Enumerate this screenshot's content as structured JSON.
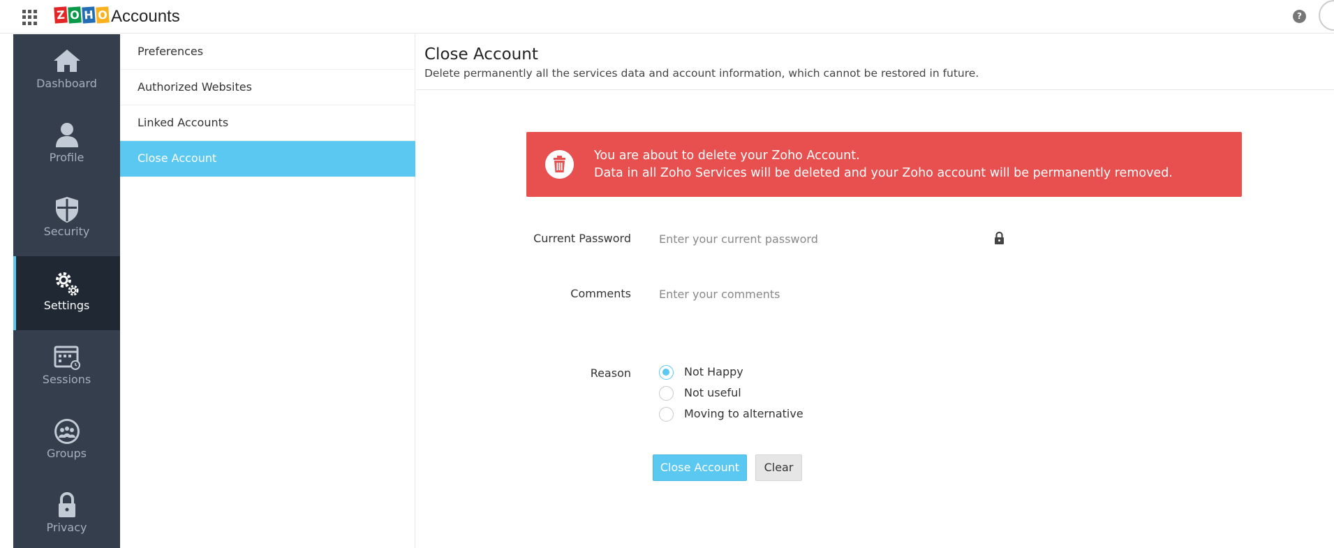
{
  "header": {
    "apps_icon": "apps-grid-icon",
    "logo_letters": [
      "Z",
      "O",
      "H",
      "O"
    ],
    "app_title": "Accounts",
    "help_icon": "help-icon",
    "help_glyph": "?"
  },
  "leftnav": {
    "items": [
      {
        "label": "Dashboard",
        "icon": "home-icon"
      },
      {
        "label": "Profile",
        "icon": "user-icon"
      },
      {
        "label": "Security",
        "icon": "shield-icon"
      },
      {
        "label": "Settings",
        "icon": "gears-icon",
        "active": true
      },
      {
        "label": "Sessions",
        "icon": "calendar-clock-icon"
      },
      {
        "label": "Groups",
        "icon": "group-icon"
      },
      {
        "label": "Privacy",
        "icon": "lock-icon"
      }
    ]
  },
  "submenu": {
    "items": [
      {
        "label": "Preferences"
      },
      {
        "label": "Authorized Websites"
      },
      {
        "label": "Linked Accounts"
      },
      {
        "label": "Close Account",
        "active": true
      }
    ]
  },
  "main": {
    "title": "Close Account",
    "description": "Delete permanently all the services data and account information, which cannot be restored in future.",
    "alert": {
      "icon": "trash-icon",
      "line1": "You are about to delete your Zoho Account.",
      "line2": "Data in all Zoho Services will be deleted and your Zoho account will be permanently removed."
    },
    "form": {
      "password_label": "Current Password",
      "password_placeholder": "Enter your current password",
      "comments_label": "Comments",
      "comments_placeholder": "Enter your comments",
      "reason_label": "Reason",
      "reasons": [
        {
          "label": "Not Happy",
          "checked": true
        },
        {
          "label": "Not useful",
          "checked": false
        },
        {
          "label": "Moving to alternative",
          "checked": false
        }
      ],
      "submit_label": "Close Account",
      "clear_label": "Clear"
    }
  },
  "colors": {
    "accent": "#5ac8f0",
    "alert": "#e84f4f",
    "nav_bg": "#343e4c",
    "nav_active_bg": "#1f2833"
  }
}
